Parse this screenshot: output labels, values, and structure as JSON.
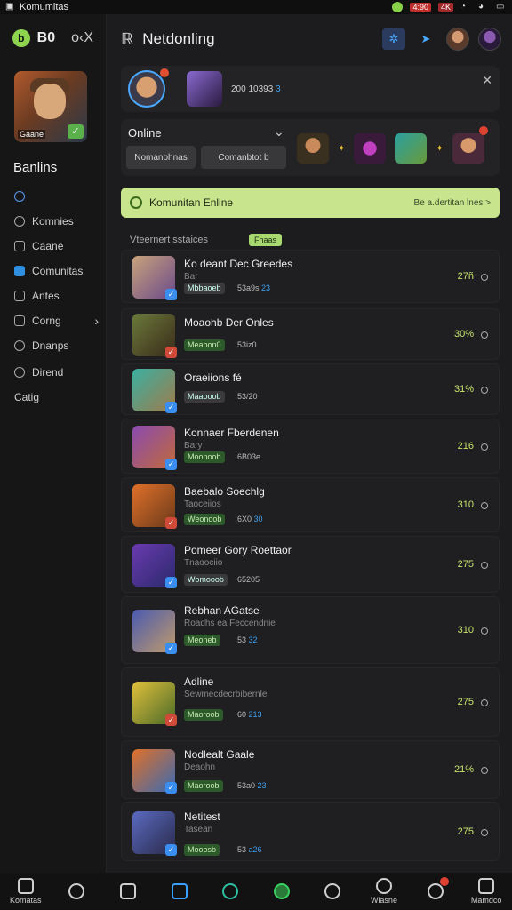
{
  "statusbar": {
    "app_title": "Komumitas",
    "badge1": "4:90",
    "badge2": "4K"
  },
  "sidebar": {
    "logo_text": "B0",
    "logo_extra": "o‹X",
    "profile_name": "Gaane",
    "heading": "Banlins",
    "items": [
      {
        "label": "",
        "icon": "globe-icon"
      },
      {
        "label": "Komnies",
        "icon": "chat-icon"
      },
      {
        "label": "Caane",
        "icon": "window-icon"
      },
      {
        "label": "Comunitas",
        "icon": "community-icon"
      },
      {
        "label": "Antes",
        "icon": "page-icon"
      },
      {
        "label": "Corng",
        "icon": "box-icon"
      },
      {
        "label": "Dnanps",
        "icon": "gamepad-icon"
      },
      {
        "label": "Dirend",
        "icon": "settings-icon"
      },
      {
        "label": "Catig",
        "icon": ""
      }
    ]
  },
  "header": {
    "title": "Netdonling"
  },
  "top_panel": {
    "stat_text": "200 10393",
    "stat_value": "3"
  },
  "online": {
    "label": "Online",
    "pill_a": "Nomanohnas",
    "pill_b": "Comanbtot b"
  },
  "banner": {
    "text": "Komunitan Enline",
    "link": "Be a.dertitan lnes  >"
  },
  "list": {
    "header_label": "Vteernert sstaices",
    "header_tag": "Fhaas",
    "rows": [
      {
        "name": "Ko deant Dec Greedes",
        "sub": "Bar",
        "tag": "Mbbaoeb",
        "meta": "53a9s",
        "meta_v": "23",
        "value": "27ñ"
      },
      {
        "name": "Moaohb Der Onles",
        "sub": "",
        "tag": "Meabon0",
        "meta": "53iz0",
        "meta_v": "",
        "value": "30%"
      },
      {
        "name": "Oraeiions fé",
        "sub": "",
        "tag": "Maaooob",
        "meta": "53/20",
        "meta_v": "",
        "value": "31%"
      },
      {
        "name": "Konnaer Fberdenen",
        "sub": "Bary",
        "tag": "Moonoob",
        "meta": "6B03e",
        "meta_v": "",
        "value": "216"
      },
      {
        "name": "Baebalo Soechlg",
        "sub": "Taoceiios",
        "tag": "Weonoob",
        "meta": "6X0",
        "meta_v": "30",
        "value": "310"
      },
      {
        "name": "Pomeer Gory Roettaor",
        "sub": "Tnaoociio",
        "tag": "Womooob",
        "meta": "65205",
        "meta_v": "",
        "value": "275"
      },
      {
        "name": "Rebhan AGatse",
        "sub": "Roadhs ea Feccendnie",
        "tag": "Meoneb",
        "meta": "53",
        "meta_v": "32",
        "value": "310"
      },
      {
        "name": "Adline",
        "sub": "Sewmecdecrbibernle",
        "tag": "Maoroob",
        "meta": "60",
        "meta_v": "213",
        "value": "275"
      },
      {
        "name": "Nodlealt Gaale",
        "sub": "Deaohn",
        "tag": "Maoroob",
        "meta": "53a0",
        "meta_v": "23",
        "value": "21%"
      },
      {
        "name": "Netitest",
        "sub": "Tasean",
        "tag": "Mooosb",
        "meta": "53",
        "meta_v": "a26",
        "value": "275"
      }
    ]
  },
  "bottomnav": {
    "first_label": "Komatas",
    "seventh_label": "Wlasne",
    "last_label": "Mamdco"
  }
}
